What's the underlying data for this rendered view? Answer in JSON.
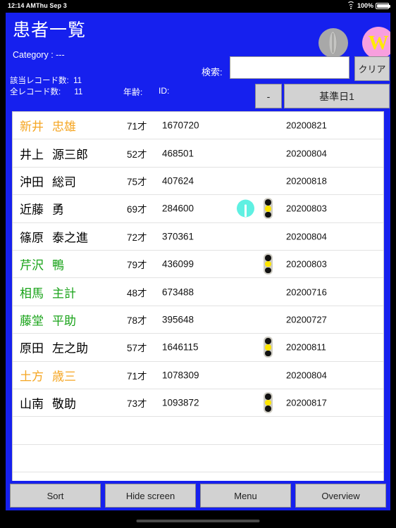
{
  "statusbar": {
    "time": "12:14 AM",
    "date": "Thu Sep 3",
    "battery_percent": "100%",
    "wifi_icon": "wifi-icon",
    "battery_icon": "battery-full-icon"
  },
  "header": {
    "title": "患者一覧",
    "category_label": "Category :  ---",
    "matching_records": "該当レコード数:  11",
    "total_records": "全レコード数:      11",
    "age_header": "年齢:",
    "id_header": "ID:",
    "search_label": "検索:",
    "search_value": "",
    "search_placeholder": "",
    "clear_button": "クリア",
    "minus_button": "-",
    "reference_date_button": "基準日1",
    "profile_icon": "profile-avatar-icon",
    "w_icon": "w-badge-icon",
    "accent_color": "#1620EE",
    "orange_color": "#F5A623",
    "green_color": "#19A319",
    "alert_color": "#5FF0E2"
  },
  "list": {
    "rows": [
      {
        "last": "新井",
        "first": "忠雄",
        "age": "71才",
        "id": "1670720",
        "date": "20200821",
        "color": "orange",
        "alert": false,
        "signal": false
      },
      {
        "last": "井上",
        "first": "源三郎",
        "age": "52才",
        "id": "468501",
        "date": "20200804",
        "color": "black",
        "alert": false,
        "signal": false
      },
      {
        "last": "沖田",
        "first": "総司",
        "age": "75才",
        "id": "407624",
        "date": "20200818",
        "color": "black",
        "alert": false,
        "signal": false
      },
      {
        "last": "近藤",
        "first": "勇",
        "age": "69才",
        "id": "284600",
        "date": "20200803",
        "color": "black",
        "alert": true,
        "signal": true
      },
      {
        "last": "篠原",
        "first": "泰之進",
        "age": "72才",
        "id": "370361",
        "date": "20200804",
        "color": "black",
        "alert": false,
        "signal": false
      },
      {
        "last": "芹沢",
        "first": "鴨",
        "age": "79才",
        "id": "436099",
        "date": "20200803",
        "color": "green",
        "alert": false,
        "signal": true
      },
      {
        "last": "相馬",
        "first": "主計",
        "age": "48才",
        "id": "673488",
        "date": "20200716",
        "color": "green",
        "alert": false,
        "signal": false
      },
      {
        "last": "藤堂",
        "first": "平助",
        "age": "78才",
        "id": "395648",
        "date": "20200727",
        "color": "green",
        "alert": false,
        "signal": false
      },
      {
        "last": "原田",
        "first": "左之助",
        "age": "57才",
        "id": "1646115",
        "date": "20200811",
        "color": "black",
        "alert": false,
        "signal": true
      },
      {
        "last": "土方",
        "first": "歳三",
        "age": "71才",
        "id": "1078309",
        "date": "20200804",
        "color": "orange",
        "alert": false,
        "signal": false
      },
      {
        "last": "山南",
        "first": "敬助",
        "age": "73才",
        "id": "1093872",
        "date": "20200817",
        "color": "black",
        "alert": false,
        "signal": true
      }
    ],
    "empty_rows": 2
  },
  "toolbar": {
    "buttons": [
      "Sort",
      "Hide screen",
      "Menu",
      "Overview"
    ]
  }
}
